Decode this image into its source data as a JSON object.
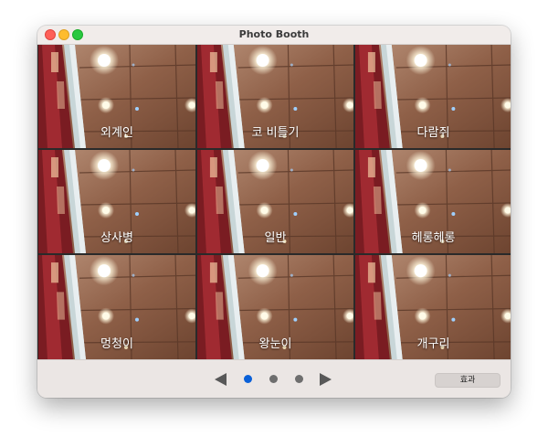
{
  "window": {
    "title": "Photo Booth"
  },
  "effects": [
    {
      "label": "외계인"
    },
    {
      "label": "코 비틀기"
    },
    {
      "label": "다람쥐"
    },
    {
      "label": "상사병"
    },
    {
      "label": "일반"
    },
    {
      "label": "헤롱헤롱"
    },
    {
      "label": "멍청이"
    },
    {
      "label": "왕눈이"
    },
    {
      "label": "개구리"
    }
  ],
  "toolbar": {
    "prev_icon": "left-arrow-icon",
    "next_icon": "right-arrow-icon",
    "page_count": 3,
    "active_page": 1,
    "effect_button_label": "효과"
  },
  "colors": {
    "accent": "#0a60d8",
    "close": "#fe5f57",
    "minimize": "#febc2e",
    "maximize": "#28c840"
  }
}
